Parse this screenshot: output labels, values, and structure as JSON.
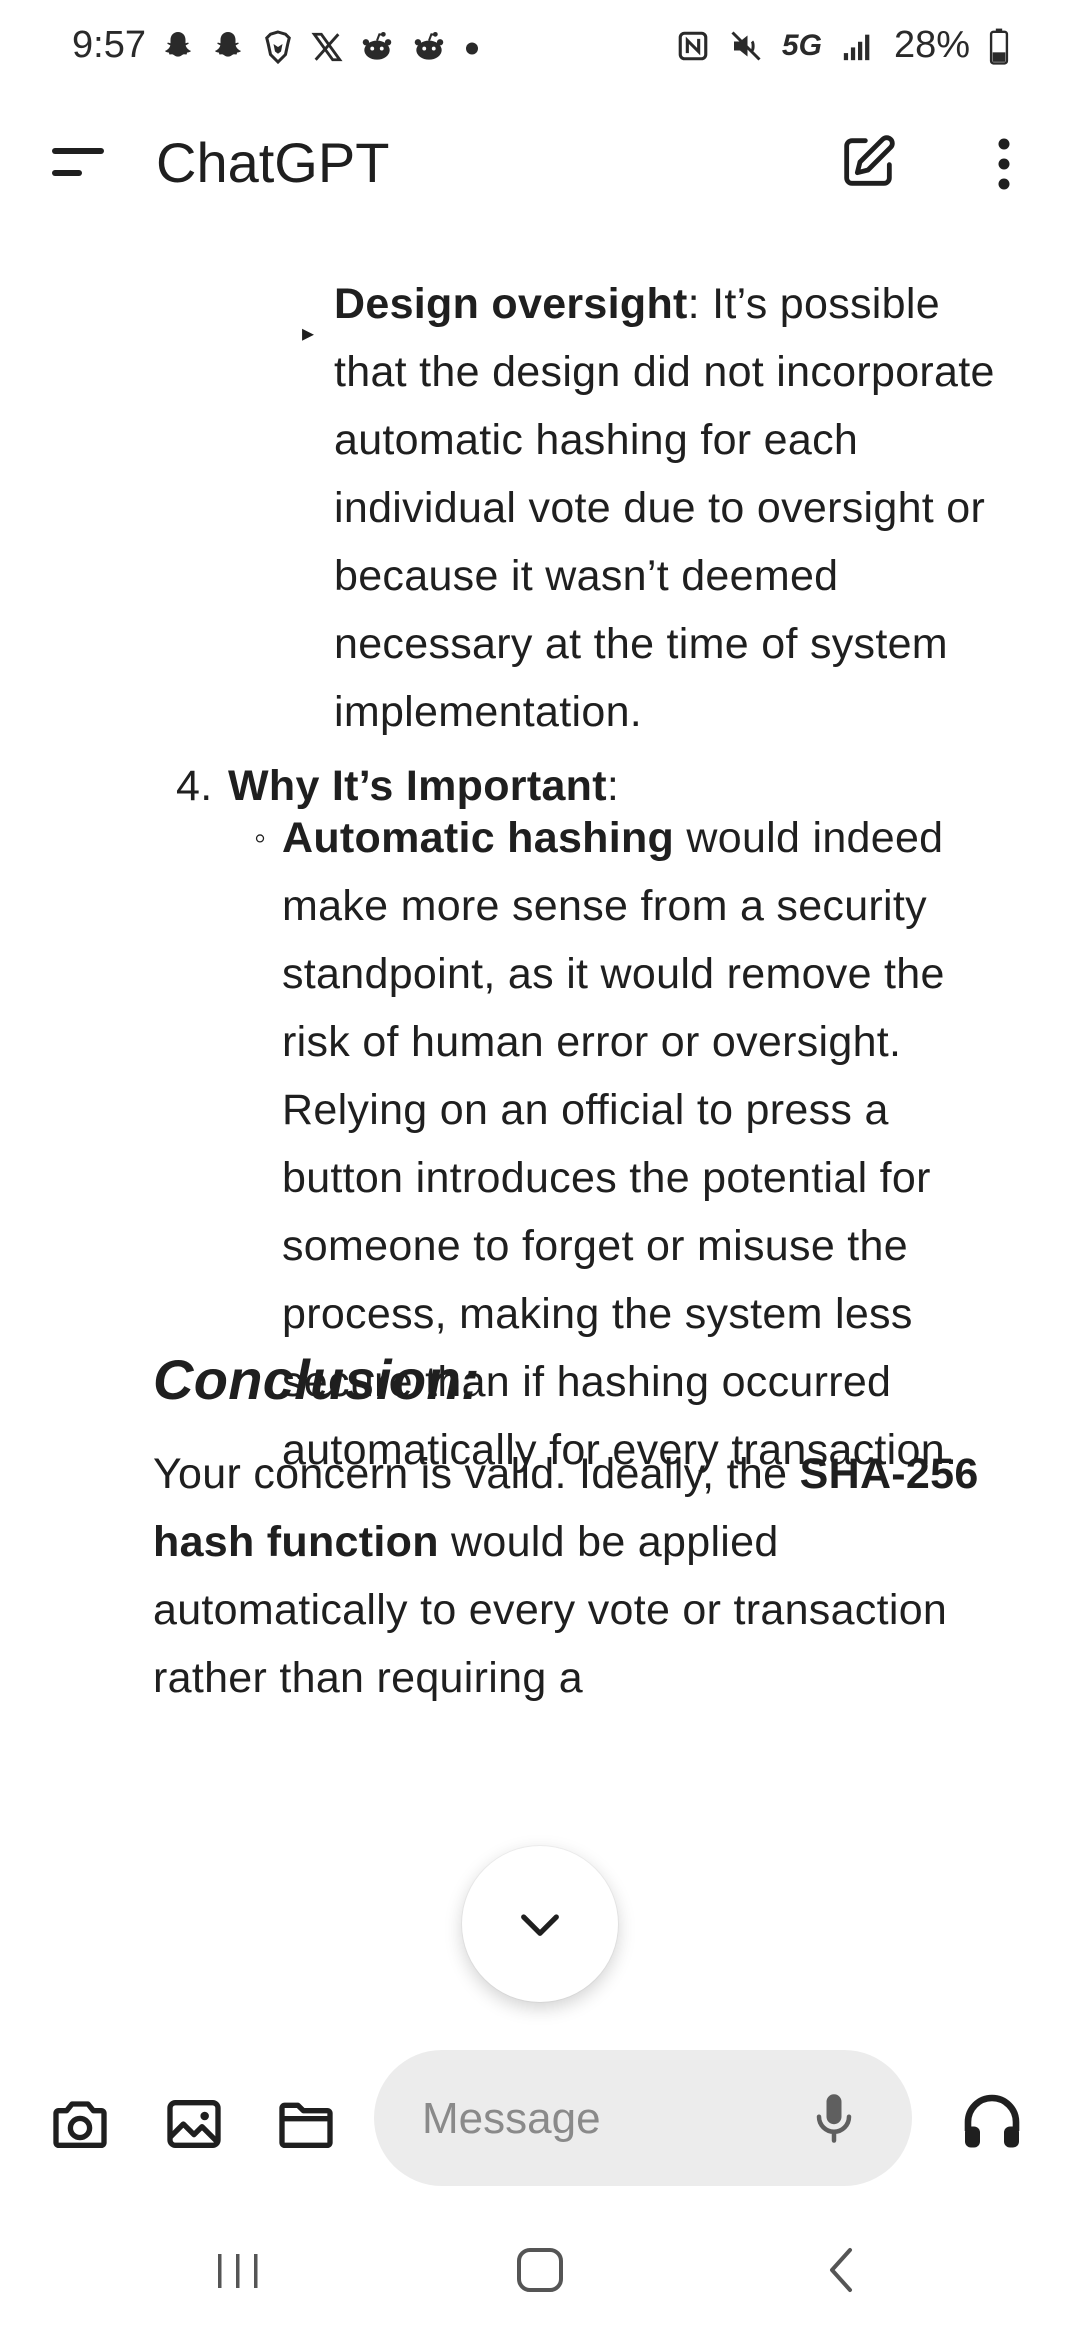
{
  "status_bar": {
    "time": "9:57",
    "network": "5G",
    "battery": "28%"
  },
  "app_bar": {
    "title": "ChatGPT"
  },
  "message": {
    "design_oversight_label": "Design oversight",
    "design_oversight_text": ": It’s possible that the design did not incorporate automatic hashing for each individual vote due to oversight or because it wasn’t deemed necessary at the time of system implementation.",
    "item4_number": "4.",
    "item4_label": "Why It’s Important",
    "item4_colon": ":",
    "auto_hashing_label": "Automatic hashing",
    "auto_hashing_text": " would indeed make more sense from a security standpoint, as it would remove the risk of human error or oversight. Relying on an official to press a button introduces the potential for someone to forget or misuse the process, making the system less secure than if hashing occurred automatically for every transaction.",
    "conclusion_heading": "Conclusion:",
    "conclusion_intro": "Your concern is valid. Ideally, the ",
    "conclusion_bold": "SHA-256 hash function",
    "conclusion_text": " would be applied automatically to every vote or transaction rather than requiring a"
  },
  "input_bar": {
    "placeholder": "Message"
  },
  "icons": {
    "menu": "menu-icon",
    "new_chat": "edit-icon",
    "more": "more-vert-icon",
    "scroll_down": "chevron-down-icon",
    "camera": "camera-icon",
    "image": "image-icon",
    "folder": "folder-icon",
    "mic": "mic-icon",
    "voice": "headphones-icon"
  }
}
